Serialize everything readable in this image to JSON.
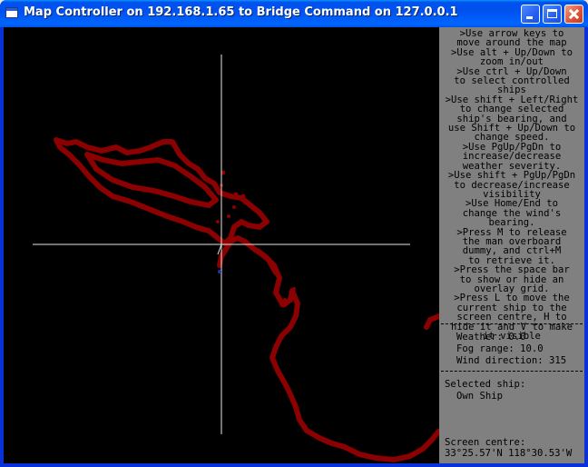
{
  "window": {
    "title": "Map Controller on 192.168.1.65 to Bridge Command on 127.0.0.1",
    "controls": [
      "minimize",
      "maximize",
      "close"
    ]
  },
  "colors": {
    "map_background": "#000000",
    "coastline": "#8b0000",
    "crosshair": "#e6e6e6",
    "panel_background": "#808080",
    "ship_marker": "#2233aa"
  },
  "help": {
    "lines": [
      ">Use arrow keys to",
      "move around the map",
      ">Use alt + Up/Down to",
      "zoom in/out",
      ">Use ctrl + Up/Down",
      "to select controlled",
      "ships",
      ">Use shift + Left/Right",
      "to change selected",
      "ship's bearing, and",
      "use Shift + Up/Down to",
      "change speed.",
      ">Use PgUp/PgDn to",
      "increase/decrease",
      "weather severity.",
      ">Use shift + PgUp/PgDn",
      "to decrease/increase",
      "visibility",
      ">Use Home/End to",
      "change the wind's",
      "bearing.",
      ">Press M to release",
      "the man overboard",
      "dummy, and ctrl+M",
      "to retrieve it.",
      ">Press the space bar",
      "to show or hide an",
      "overlay grid.",
      ">Press L to move the",
      "current ship to the",
      "screen centre, H to",
      "hide it and V to make",
      "it visible"
    ]
  },
  "status": {
    "weather": "Weather: 0.0",
    "fog": "Fog range: 10.0",
    "wind": "Wind direction: 315"
  },
  "selection": {
    "label": "Selected ship:",
    "value": "Own Ship"
  },
  "screen_centre": {
    "label": "Screen centre:",
    "value": "33°25.57'N 118°30.53'W"
  }
}
